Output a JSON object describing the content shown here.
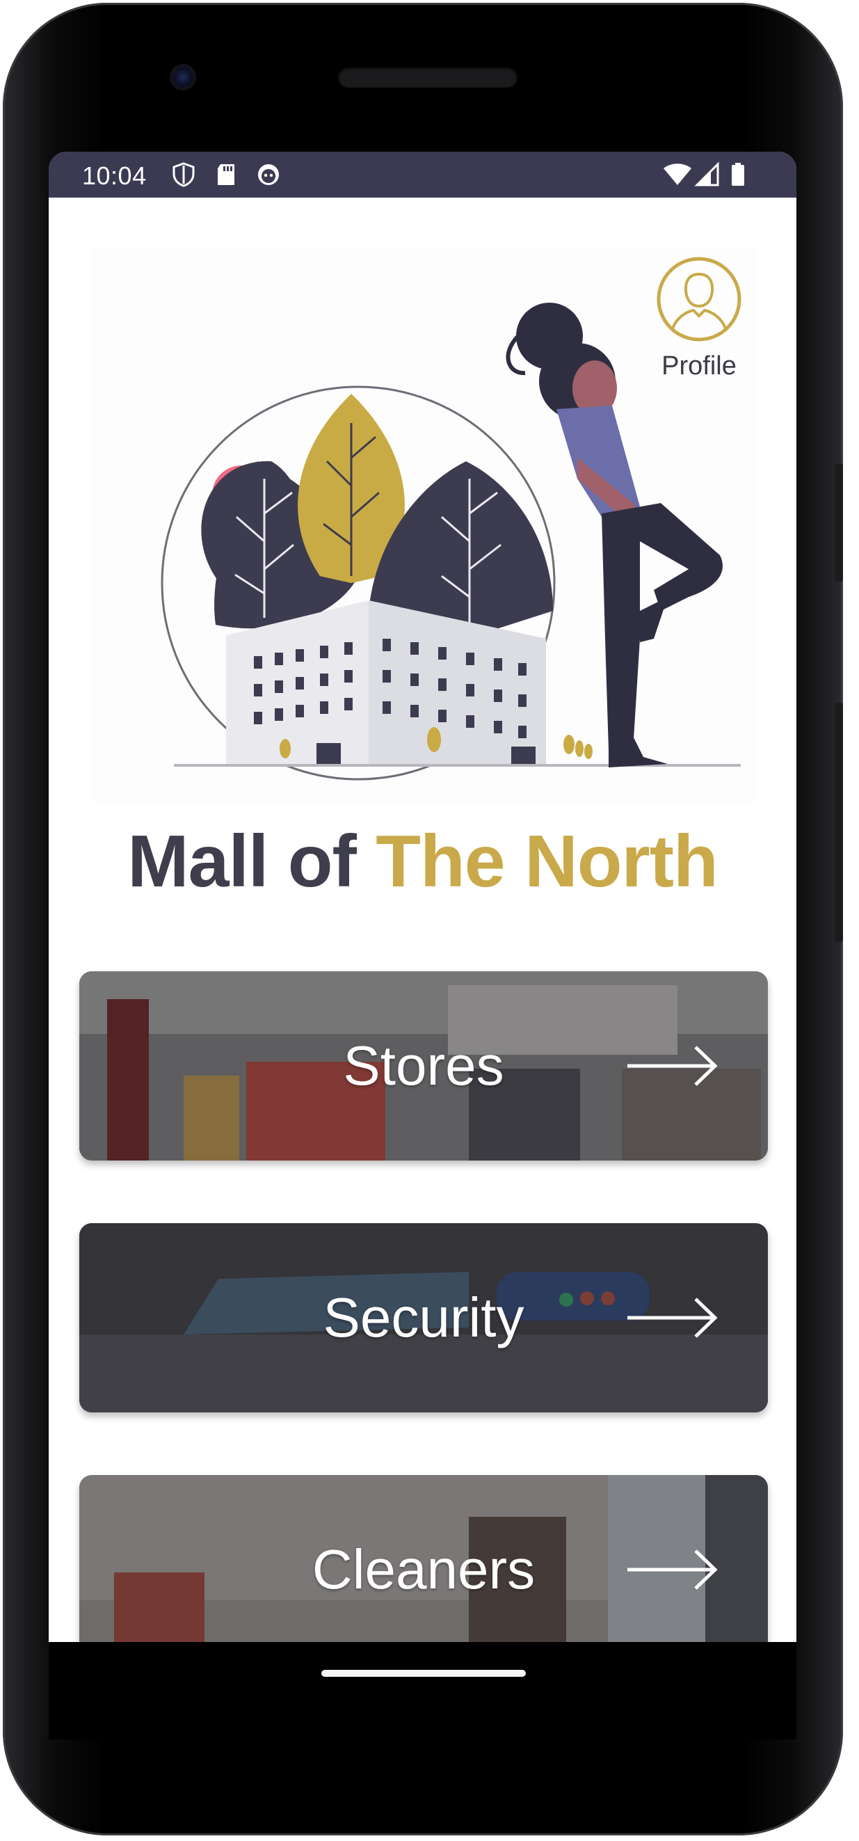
{
  "status_bar": {
    "time": "10:04",
    "icons": [
      "shield-icon",
      "sd-card-icon",
      "android-icon",
      "wifi-icon",
      "signal-icon",
      "battery-icon"
    ]
  },
  "header": {
    "profile_label": "Profile",
    "profile_icon": "user-avatar-icon"
  },
  "title": {
    "part1": "Mall of",
    "part2": "The North"
  },
  "colors": {
    "primary_dark": "#3f3e4d",
    "accent_gold": "#c9a94a",
    "status_bar": "#3b3a52"
  },
  "cards": [
    {
      "label": "Stores",
      "icon": "arrow-right-icon"
    },
    {
      "label": "Security",
      "icon": "arrow-right-icon"
    },
    {
      "label": "Cleaners",
      "icon": "arrow-right-icon"
    }
  ]
}
